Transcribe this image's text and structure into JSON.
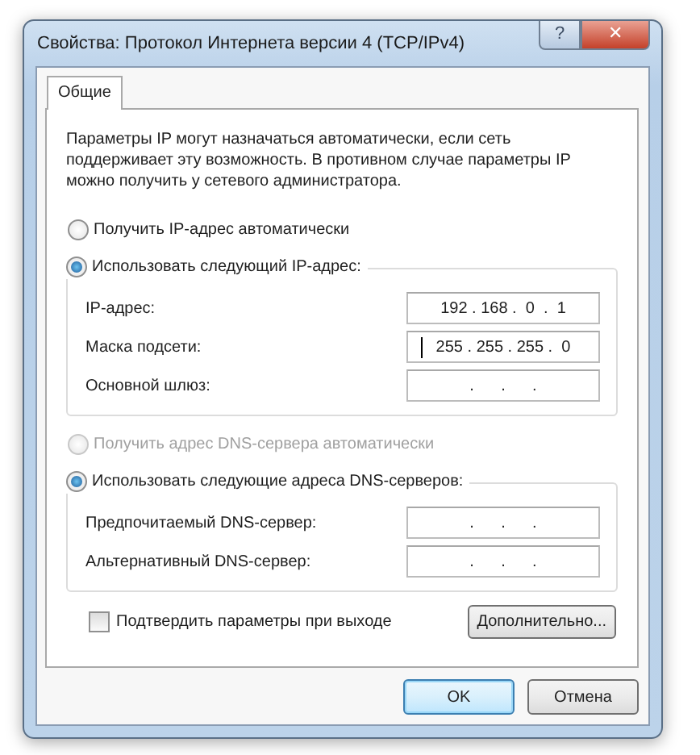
{
  "window": {
    "title": "Свойства: Протокол Интернета версии 4 (TCP/IPv4)",
    "help_button": "?",
    "close_button": "✕"
  },
  "tabs": [
    {
      "label": "Общие",
      "selected": true
    }
  ],
  "description": "Параметры IP могут назначаться автоматически, если сеть поддерживает эту возможность. В противном случае параметры IP можно получить у сетевого администратора.",
  "ip_auto": {
    "label": "Получить IP-адрес автоматически",
    "selected": false,
    "disabled": false
  },
  "ip_group": {
    "label": "Использовать следующий IP-адрес:",
    "selected": true,
    "fields": [
      {
        "label": "IP-адрес:",
        "value": "192 . 168 .  0  .  1",
        "focused": false
      },
      {
        "label": "Маска подсети:",
        "value": "255 . 255 . 255 .  0",
        "focused": true
      },
      {
        "label": "Основной шлюз:",
        "value": ".      .      .",
        "focused": false
      }
    ]
  },
  "dns_auto": {
    "label": "Получить адрес DNS-сервера автоматически",
    "selected": false,
    "disabled": true
  },
  "dns_group": {
    "label": "Использовать следующие адреса DNS-серверов:",
    "selected": true,
    "fields": [
      {
        "label": "Предпочитаемый DNS-сервер:",
        "value": ".      .      .",
        "focused": false
      },
      {
        "label": "Альтернативный DNS-сервер:",
        "value": ".      .      .",
        "focused": false
      }
    ]
  },
  "validate": {
    "label": "Подтвердить параметры при выходе",
    "checked": false
  },
  "advanced_button": "Дополнительно...",
  "buttons": [
    {
      "label": "OK",
      "default": true
    },
    {
      "label": "Отмена",
      "default": false
    }
  ]
}
